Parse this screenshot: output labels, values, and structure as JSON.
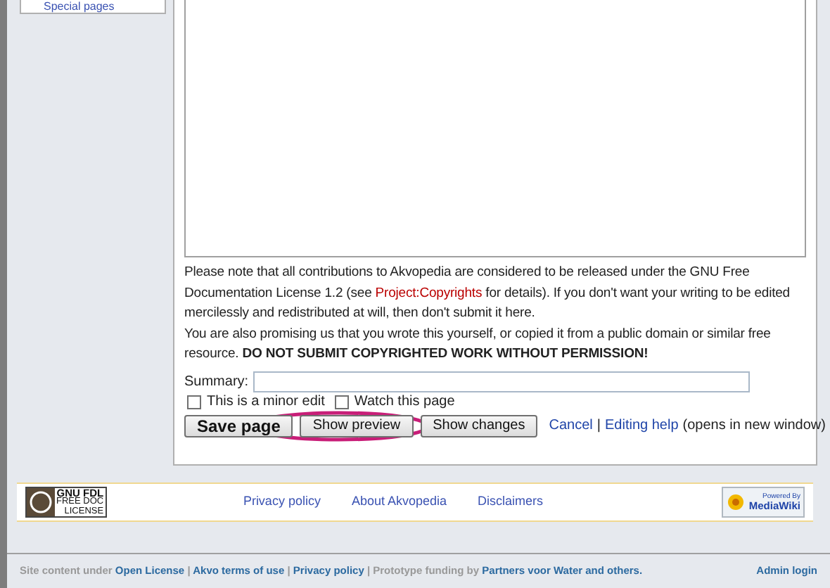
{
  "sidebar": {
    "items": [
      {
        "label": "Special pages"
      }
    ]
  },
  "notice": {
    "paragraph_1": {
      "before": "Please note that all contributions to Akvopedia are considered to be released under the GNU Free Documentation License 1.2 (see ",
      "link": "Project:Copyrights",
      "after": " for details). If you don't want your writing to be edited mercilessly and redistributed at will, then don't submit it here."
    },
    "paragraph_2": "You are also promising us that you wrote this yourself, or copied it from a public domain or similar free resource. **DO NOT SUBMIT COPYRIGHTED WORK WITHOUT PERMISSION!**"
  },
  "summary": {
    "label": "Summary:"
  },
  "checkboxes": [
    {
      "label": "This is a minor edit",
      "checked": false
    },
    {
      "label": "Watch this page",
      "checked": false
    }
  ],
  "buttons": [
    {
      "label": "Save page",
      "kind": "primary"
    },
    {
      "label": "Show preview",
      "kind": "normal"
    },
    {
      "label": "Show changes",
      "kind": "normal"
    }
  ],
  "edit_links": {
    "cancel": "Cancel",
    "separator": "|",
    "help": "Editing help",
    "help_note": "(opens in new window)"
  },
  "footer": {
    "license_badge": {
      "line_1": "GNU FDL",
      "line_2": "FREE DOC",
      "line_3": "LICENSE"
    },
    "links": [
      "Privacy policy",
      "About Akvopedia",
      "Disclaimers"
    ],
    "powered_badge": {
      "line_1": "Powered By",
      "line_2": "MediaWiki"
    }
  },
  "bottom_bar": {
    "parts": [
      {
        "text": "Site content under ",
        "kind": "plain"
      },
      {
        "text": "Open License",
        "kind": "link"
      },
      {
        "text": " | ",
        "kind": "plain"
      },
      {
        "text": "Akvo terms of use",
        "kind": "link"
      },
      {
        "text": " | ",
        "kind": "plain"
      },
      {
        "text": "Privacy policy",
        "kind": "link"
      },
      {
        "text": " | Prototype funding by ",
        "kind": "plain"
      },
      {
        "text": "Partners voor Water and others.",
        "kind": "link"
      }
    ],
    "admin": "Admin login"
  }
}
